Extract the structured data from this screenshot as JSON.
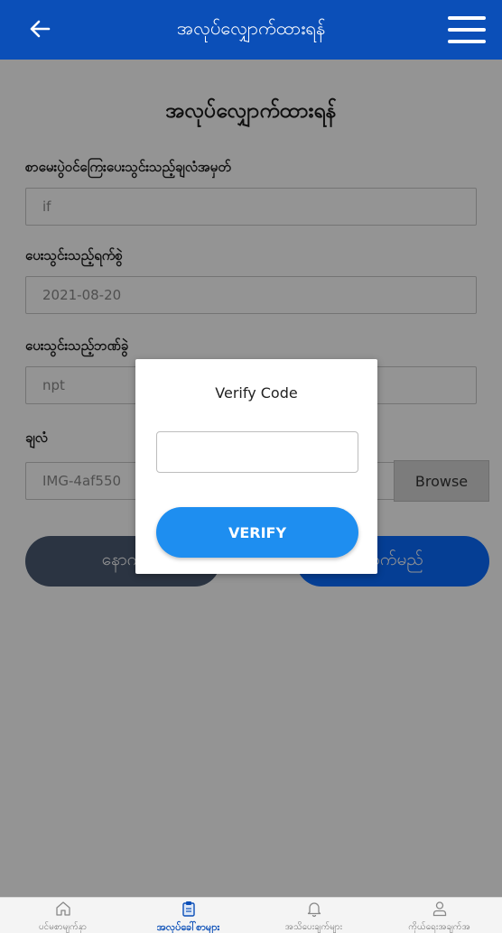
{
  "appbar": {
    "title": "အလုပ်လျှောက်ထားရန်",
    "back_icon": "arrow-left-icon",
    "menu_icon": "hamburger-menu-icon"
  },
  "form": {
    "heading": "အလုပ်လျှောက်ထားရန်",
    "fields": [
      {
        "label": "စာမေးပွဲဝင်ကြေးပေးသွင်းသည့်ချလံအမှတ်",
        "value": "if"
      },
      {
        "label": "ပေးသွင်းသည့်ရက်စွဲ",
        "value": "2021-08-20"
      },
      {
        "label": "ပေးသွင်းသည့်ဘဏ်ခွဲ",
        "value": "npt"
      },
      {
        "label": "ချလံ",
        "value": "IMG-4af550"
      }
    ],
    "browse_label": "Browse",
    "back_button_label": "နောက်",
    "submit_button_label": "ာက်မည်"
  },
  "dialog": {
    "title": "Verify Code",
    "input_value": "",
    "verify_label": "VERIFY"
  },
  "bottom_nav": {
    "items": [
      {
        "label": "ပင်မစာမျက်နှာ",
        "icon": "home-icon",
        "active": false
      },
      {
        "label": "အလုပ်ခေါ်စာများ",
        "icon": "clipboard-icon",
        "active": true
      },
      {
        "label": "အသိပေးချက်များ",
        "icon": "bell-icon",
        "active": false
      },
      {
        "label": "ကိုယ်ရေးအချက်အ",
        "icon": "person-icon",
        "active": false
      }
    ]
  },
  "colors": {
    "primary": "#0b4fb8",
    "verify_button": "#1e8ef0",
    "submit_button": "#0a6cff",
    "back_button": "#4a5a73"
  }
}
